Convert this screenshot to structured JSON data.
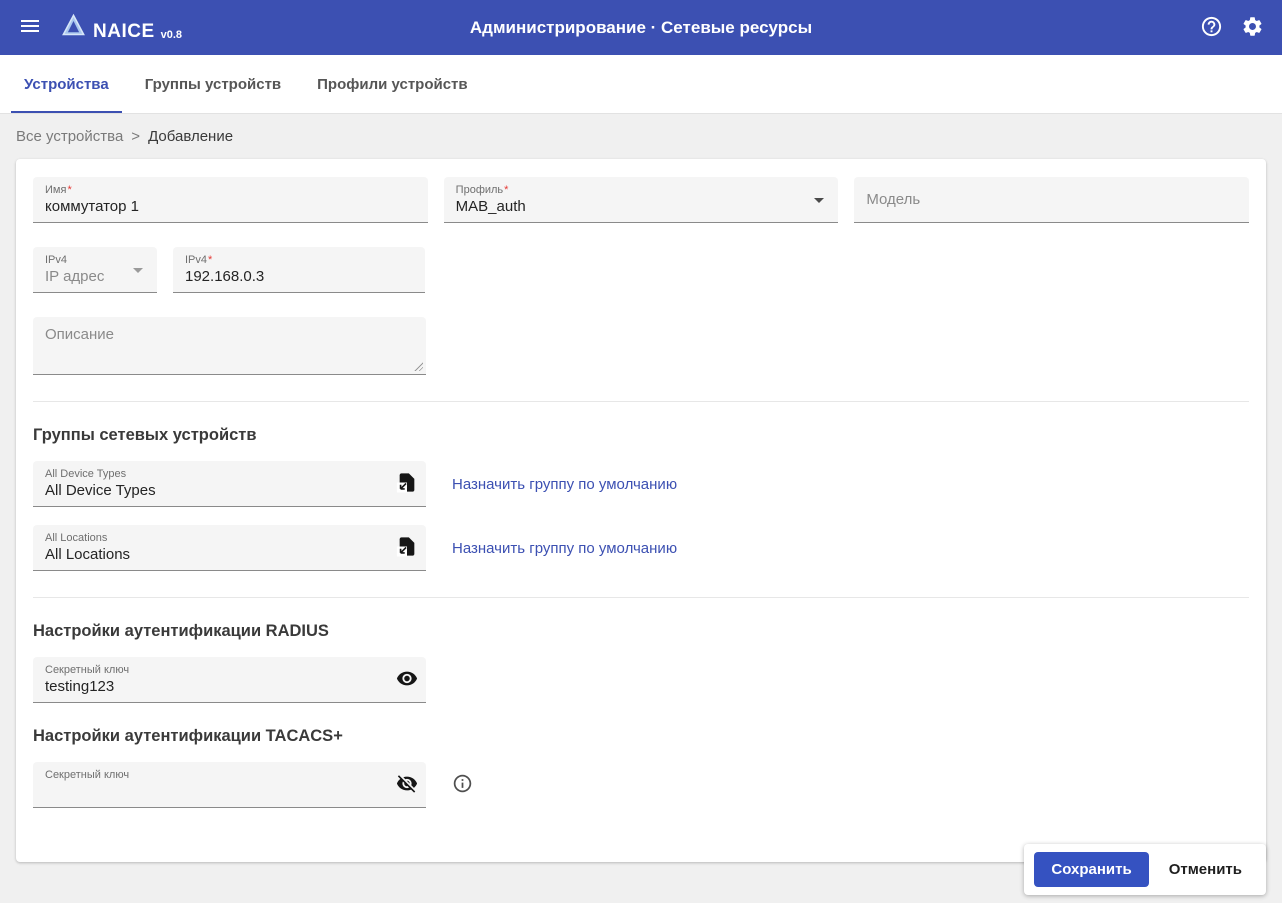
{
  "colors": {
    "app_bar": "#3c50b2",
    "accent": "#3c50b2",
    "link": "#3c50b2",
    "required_mark": "#e53935",
    "save_button": "#3552c1",
    "field_background": "#f5f5f5",
    "page_background": "#f0f0f0"
  },
  "icons": {
    "menu": "hamburger-icon",
    "logo": "naice-logo-icon",
    "help": "help-icon",
    "settings": "gear-icon",
    "dropdown": "chevron-down-icon",
    "group_picker": "file-select-icon",
    "show_password": "eye-icon",
    "hide_password": "eye-off-icon",
    "info": "info-icon",
    "resize": "resize-handle"
  },
  "app_bar": {
    "logo_text": "NAICE",
    "version": "v0.8",
    "title": "Администрирование · Сетевые ресурсы"
  },
  "tabs": [
    {
      "label": "Устройства",
      "active": true
    },
    {
      "label": "Группы устройств",
      "active": false
    },
    {
      "label": "Профили устройств",
      "active": false
    }
  ],
  "breadcrumb": {
    "root": "Все устройства",
    "separator": ">",
    "current": "Добавление"
  },
  "form": {
    "name": {
      "label": "Имя",
      "required_mark": "*",
      "value": "коммутатор 1"
    },
    "profile": {
      "label": "Профиль",
      "required_mark": "*",
      "value": "MAB_auth"
    },
    "model": {
      "label": "Модель",
      "value": ""
    },
    "ip_type": {
      "label": "IPv4",
      "value": "IP адрес"
    },
    "ip_address": {
      "label": "IPv4",
      "required_mark": "*",
      "value": "192.168.0.3"
    },
    "description": {
      "label": "Описание",
      "value": ""
    }
  },
  "groups_section": {
    "title": "Группы сетевых устройств",
    "items": [
      {
        "label": "All Device Types",
        "value": "All Device Types",
        "link_label": "Назначить группу по умолчанию"
      },
      {
        "label": "All Locations",
        "value": "All Locations",
        "link_label": "Назначить группу по умолчанию"
      }
    ]
  },
  "radius_section": {
    "title": "Настройки аутентификации RADIUS",
    "secret": {
      "label": "Секретный ключ",
      "value": "testing123"
    }
  },
  "tacacs_section": {
    "title": "Настройки аутентификации TACACS+",
    "secret": {
      "label": "Секретный ключ",
      "value": ""
    }
  },
  "actions": {
    "save_label": "Сохранить",
    "cancel_label": "Отменить"
  }
}
